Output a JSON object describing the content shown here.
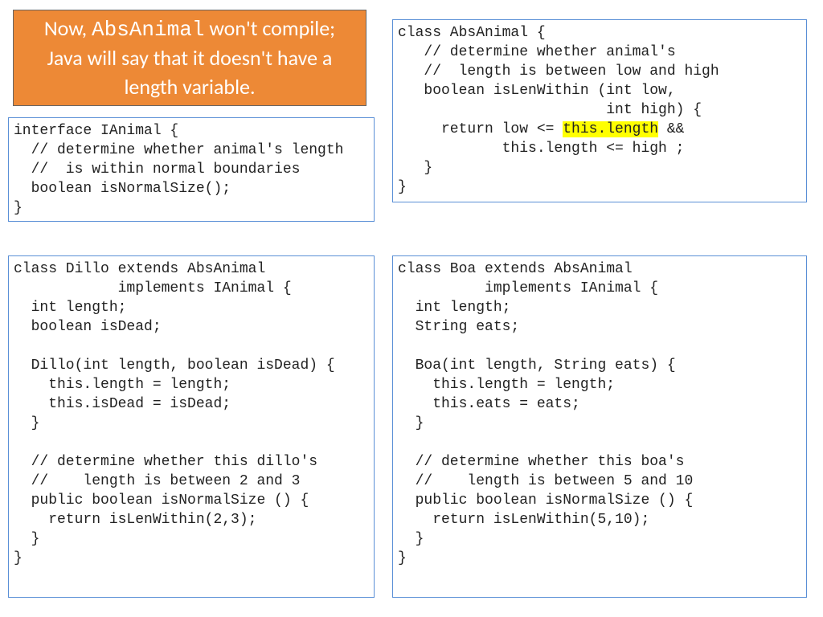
{
  "callout": {
    "prefix": "Now, ",
    "code": "AbsAnimal",
    "suffix": " won't compile; Java will say that it doesn't have a length variable."
  },
  "ianimal": {
    "l1": "interface IAnimal {",
    "l2": "  // determine whether animal's length",
    "l3": "  //  is within normal boundaries",
    "l4": "  boolean isNormalSize();",
    "l5": "}"
  },
  "abs": {
    "l1": "class AbsAnimal {",
    "l2": "   // determine whether animal's",
    "l3": "   //  length is between low and high",
    "l4": "   boolean isLenWithin (int low,",
    "l5": "                        int high) {",
    "l6a": "     return low <= ",
    "l6h": "this.length",
    "l6b": " &&",
    "l7": "            this.length <= high ;",
    "l8": "   }",
    "l9": "}"
  },
  "dillo": {
    "l1": "class Dillo extends AbsAnimal",
    "l2": "            implements IAnimal {",
    "l3": "  int length;",
    "l4": "  boolean isDead;",
    "l5": "",
    "l6": "  Dillo(int length, boolean isDead) {",
    "l7": "    this.length = length;",
    "l8": "    this.isDead = isDead;",
    "l9": "  }",
    "l10": "",
    "l11": "  // determine whether this dillo's",
    "l12": "  //    length is between 2 and 3",
    "l13": "  public boolean isNormalSize () {",
    "l14": "    return isLenWithin(2,3);",
    "l15": "  }",
    "l16": "}"
  },
  "boa": {
    "l1": "class Boa extends AbsAnimal",
    "l2": "          implements IAnimal {",
    "l3": "  int length;",
    "l4": "  String eats;",
    "l5": "",
    "l6": "  Boa(int length, String eats) {",
    "l7": "    this.length = length;",
    "l8": "    this.eats = eats;",
    "l9": "  }",
    "l10": "",
    "l11": "  // determine whether this boa's",
    "l12": "  //    length is between 5 and 10",
    "l13": "  public boolean isNormalSize () {",
    "l14": "    return isLenWithin(5,10);",
    "l15": "  }",
    "l16": "}"
  }
}
